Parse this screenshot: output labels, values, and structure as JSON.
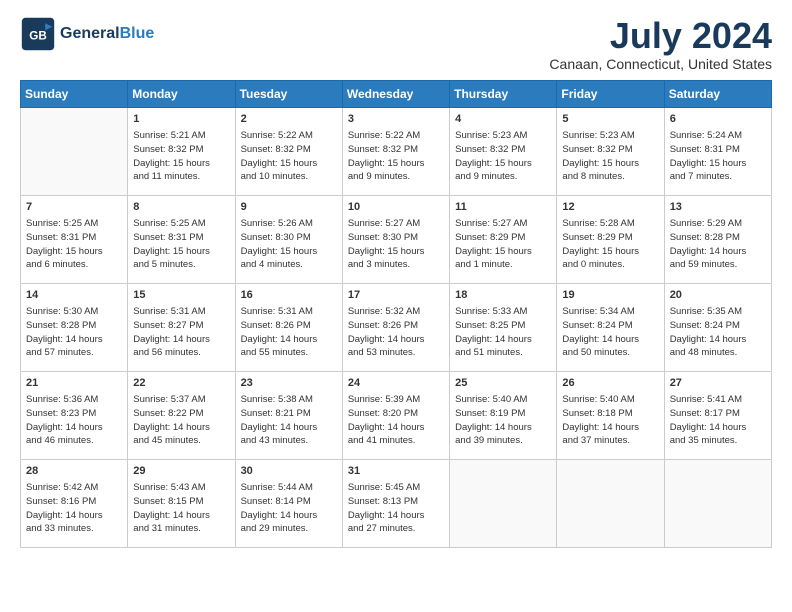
{
  "logo": {
    "general": "General",
    "blue": "Blue"
  },
  "header": {
    "month": "July 2024",
    "location": "Canaan, Connecticut, United States"
  },
  "weekdays": [
    "Sunday",
    "Monday",
    "Tuesday",
    "Wednesday",
    "Thursday",
    "Friday",
    "Saturday"
  ],
  "weeks": [
    [
      {
        "day": "",
        "content": ""
      },
      {
        "day": "1",
        "content": "Sunrise: 5:21 AM\nSunset: 8:32 PM\nDaylight: 15 hours\nand 11 minutes."
      },
      {
        "day": "2",
        "content": "Sunrise: 5:22 AM\nSunset: 8:32 PM\nDaylight: 15 hours\nand 10 minutes."
      },
      {
        "day": "3",
        "content": "Sunrise: 5:22 AM\nSunset: 8:32 PM\nDaylight: 15 hours\nand 9 minutes."
      },
      {
        "day": "4",
        "content": "Sunrise: 5:23 AM\nSunset: 8:32 PM\nDaylight: 15 hours\nand 9 minutes."
      },
      {
        "day": "5",
        "content": "Sunrise: 5:23 AM\nSunset: 8:32 PM\nDaylight: 15 hours\nand 8 minutes."
      },
      {
        "day": "6",
        "content": "Sunrise: 5:24 AM\nSunset: 8:31 PM\nDaylight: 15 hours\nand 7 minutes."
      }
    ],
    [
      {
        "day": "7",
        "content": "Sunrise: 5:25 AM\nSunset: 8:31 PM\nDaylight: 15 hours\nand 6 minutes."
      },
      {
        "day": "8",
        "content": "Sunrise: 5:25 AM\nSunset: 8:31 PM\nDaylight: 15 hours\nand 5 minutes."
      },
      {
        "day": "9",
        "content": "Sunrise: 5:26 AM\nSunset: 8:30 PM\nDaylight: 15 hours\nand 4 minutes."
      },
      {
        "day": "10",
        "content": "Sunrise: 5:27 AM\nSunset: 8:30 PM\nDaylight: 15 hours\nand 3 minutes."
      },
      {
        "day": "11",
        "content": "Sunrise: 5:27 AM\nSunset: 8:29 PM\nDaylight: 15 hours\nand 1 minute."
      },
      {
        "day": "12",
        "content": "Sunrise: 5:28 AM\nSunset: 8:29 PM\nDaylight: 15 hours\nand 0 minutes."
      },
      {
        "day": "13",
        "content": "Sunrise: 5:29 AM\nSunset: 8:28 PM\nDaylight: 14 hours\nand 59 minutes."
      }
    ],
    [
      {
        "day": "14",
        "content": "Sunrise: 5:30 AM\nSunset: 8:28 PM\nDaylight: 14 hours\nand 57 minutes."
      },
      {
        "day": "15",
        "content": "Sunrise: 5:31 AM\nSunset: 8:27 PM\nDaylight: 14 hours\nand 56 minutes."
      },
      {
        "day": "16",
        "content": "Sunrise: 5:31 AM\nSunset: 8:26 PM\nDaylight: 14 hours\nand 55 minutes."
      },
      {
        "day": "17",
        "content": "Sunrise: 5:32 AM\nSunset: 8:26 PM\nDaylight: 14 hours\nand 53 minutes."
      },
      {
        "day": "18",
        "content": "Sunrise: 5:33 AM\nSunset: 8:25 PM\nDaylight: 14 hours\nand 51 minutes."
      },
      {
        "day": "19",
        "content": "Sunrise: 5:34 AM\nSunset: 8:24 PM\nDaylight: 14 hours\nand 50 minutes."
      },
      {
        "day": "20",
        "content": "Sunrise: 5:35 AM\nSunset: 8:24 PM\nDaylight: 14 hours\nand 48 minutes."
      }
    ],
    [
      {
        "day": "21",
        "content": "Sunrise: 5:36 AM\nSunset: 8:23 PM\nDaylight: 14 hours\nand 46 minutes."
      },
      {
        "day": "22",
        "content": "Sunrise: 5:37 AM\nSunset: 8:22 PM\nDaylight: 14 hours\nand 45 minutes."
      },
      {
        "day": "23",
        "content": "Sunrise: 5:38 AM\nSunset: 8:21 PM\nDaylight: 14 hours\nand 43 minutes."
      },
      {
        "day": "24",
        "content": "Sunrise: 5:39 AM\nSunset: 8:20 PM\nDaylight: 14 hours\nand 41 minutes."
      },
      {
        "day": "25",
        "content": "Sunrise: 5:40 AM\nSunset: 8:19 PM\nDaylight: 14 hours\nand 39 minutes."
      },
      {
        "day": "26",
        "content": "Sunrise: 5:40 AM\nSunset: 8:18 PM\nDaylight: 14 hours\nand 37 minutes."
      },
      {
        "day": "27",
        "content": "Sunrise: 5:41 AM\nSunset: 8:17 PM\nDaylight: 14 hours\nand 35 minutes."
      }
    ],
    [
      {
        "day": "28",
        "content": "Sunrise: 5:42 AM\nSunset: 8:16 PM\nDaylight: 14 hours\nand 33 minutes."
      },
      {
        "day": "29",
        "content": "Sunrise: 5:43 AM\nSunset: 8:15 PM\nDaylight: 14 hours\nand 31 minutes."
      },
      {
        "day": "30",
        "content": "Sunrise: 5:44 AM\nSunset: 8:14 PM\nDaylight: 14 hours\nand 29 minutes."
      },
      {
        "day": "31",
        "content": "Sunrise: 5:45 AM\nSunset: 8:13 PM\nDaylight: 14 hours\nand 27 minutes."
      },
      {
        "day": "",
        "content": ""
      },
      {
        "day": "",
        "content": ""
      },
      {
        "day": "",
        "content": ""
      }
    ]
  ]
}
